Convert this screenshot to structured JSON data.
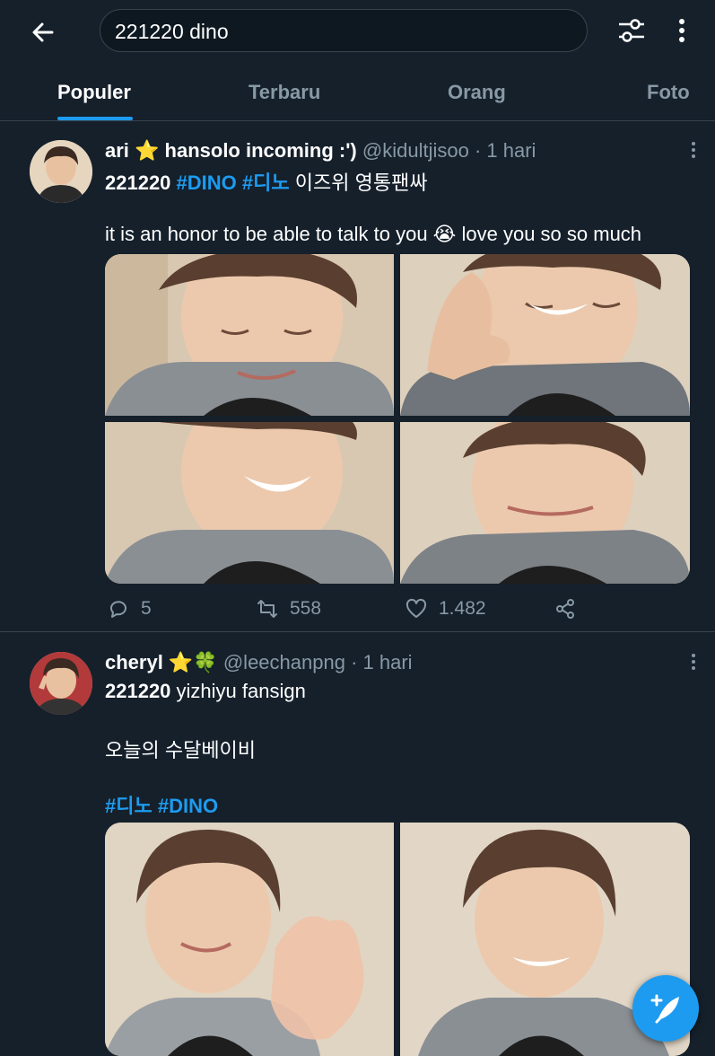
{
  "search": {
    "query": "221220 dino"
  },
  "tabs": [
    "Populer",
    "Terbaru",
    "Orang",
    "Foto"
  ],
  "tweets": [
    {
      "name": "ari ⭐ hansolo incoming :')",
      "handle": "@kidultjisoo",
      "time": "· 1 hari",
      "lines": {
        "date": "221220",
        "tag1": "#DINO",
        "tag2": "#디노",
        "korean": "이즈위 영통팬싸",
        "body": "it is an honor to be able to talk to you 😭 love you so so much"
      },
      "stats": {
        "replies": "5",
        "retweets": "558",
        "likes": "1.482"
      }
    },
    {
      "name": "cheryl ⭐🍀",
      "handle": "@leechanpng",
      "time": "· 1 hari",
      "lines": {
        "date": "221220",
        "event": "yizhiyu fansign",
        "korean": "오늘의 수달베이비",
        "tag1": "#디노",
        "tag2": "#DINO"
      }
    }
  ],
  "colors": {
    "background": "#15202b",
    "accent": "#1d9bf0",
    "muted": "#8899a6",
    "divider": "#38444d"
  },
  "icons": {
    "back": "arrow-left-icon",
    "filter": "sliders-icon",
    "more": "more-vertical-icon",
    "reply": "reply-icon",
    "retweet": "retweet-icon",
    "like": "heart-icon",
    "share": "share-icon",
    "compose": "compose-feather-icon"
  }
}
